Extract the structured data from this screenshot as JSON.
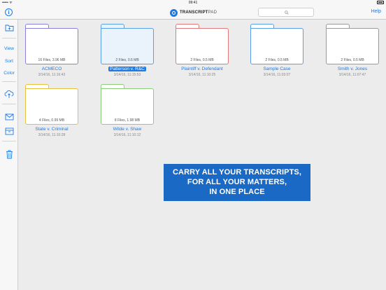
{
  "status_bar": {
    "signal": "•••••  ᯤ",
    "time": "09:41"
  },
  "navbar": {
    "logo_text_bold": "TRANSCRIPT",
    "logo_text_thin": "PAD",
    "help_label": "Help"
  },
  "sidebar": {
    "view_label": "View",
    "sort_label": "Sort",
    "color_label": "Color"
  },
  "folders": [
    {
      "name": "ACMECO",
      "meta": "16 Files, 3.96 MB",
      "date": "3/14/16, 11:16:43",
      "color": "#8b80d8"
    },
    {
      "name": "Patterson v. R&C",
      "meta": "2 Files, 0.6 MB",
      "date": "3/14/16, 11:15:53",
      "color": "#5aa0e6",
      "selected": true
    },
    {
      "name": "Plaintiff v. Defendant",
      "meta": "2 Files, 0.5 MB",
      "date": "3/14/16, 11:10:25",
      "color": "#e07a7a"
    },
    {
      "name": "Sample Case",
      "meta": "2 Files, 0.5 MB",
      "date": "3/14/16, 11:03:07",
      "color": "#5aa0e6"
    },
    {
      "name": "Smith v. Jones",
      "meta": "2 Files, 0.5 MB",
      "date": "3/14/16, 11:07:47",
      "color": "#9a9a9a"
    },
    {
      "name": "State v. Criminal",
      "meta": "4 Files, 0.99 MB",
      "date": "3/14/16, 11:10:28",
      "color": "#e8c040"
    },
    {
      "name": "Wilde v. Shaw",
      "meta": "8 Files, 1.98 MB",
      "date": "3/14/16, 11:10:12",
      "color": "#8ccf7a"
    }
  ],
  "banner": {
    "line1": "CARRY ALL YOUR TRANSCRIPTS,",
    "line2": "FOR ALL YOUR MATTERS,",
    "line3": "IN ONE PLACE"
  },
  "colors": {
    "accent": "#1a7ae6",
    "banner": "#1a69c4"
  },
  "icons": [
    "info-icon",
    "search-icon",
    "new-folder-icon",
    "cloud-upload-icon",
    "mail-icon",
    "archive-icon",
    "trash-icon",
    "battery-icon"
  ]
}
